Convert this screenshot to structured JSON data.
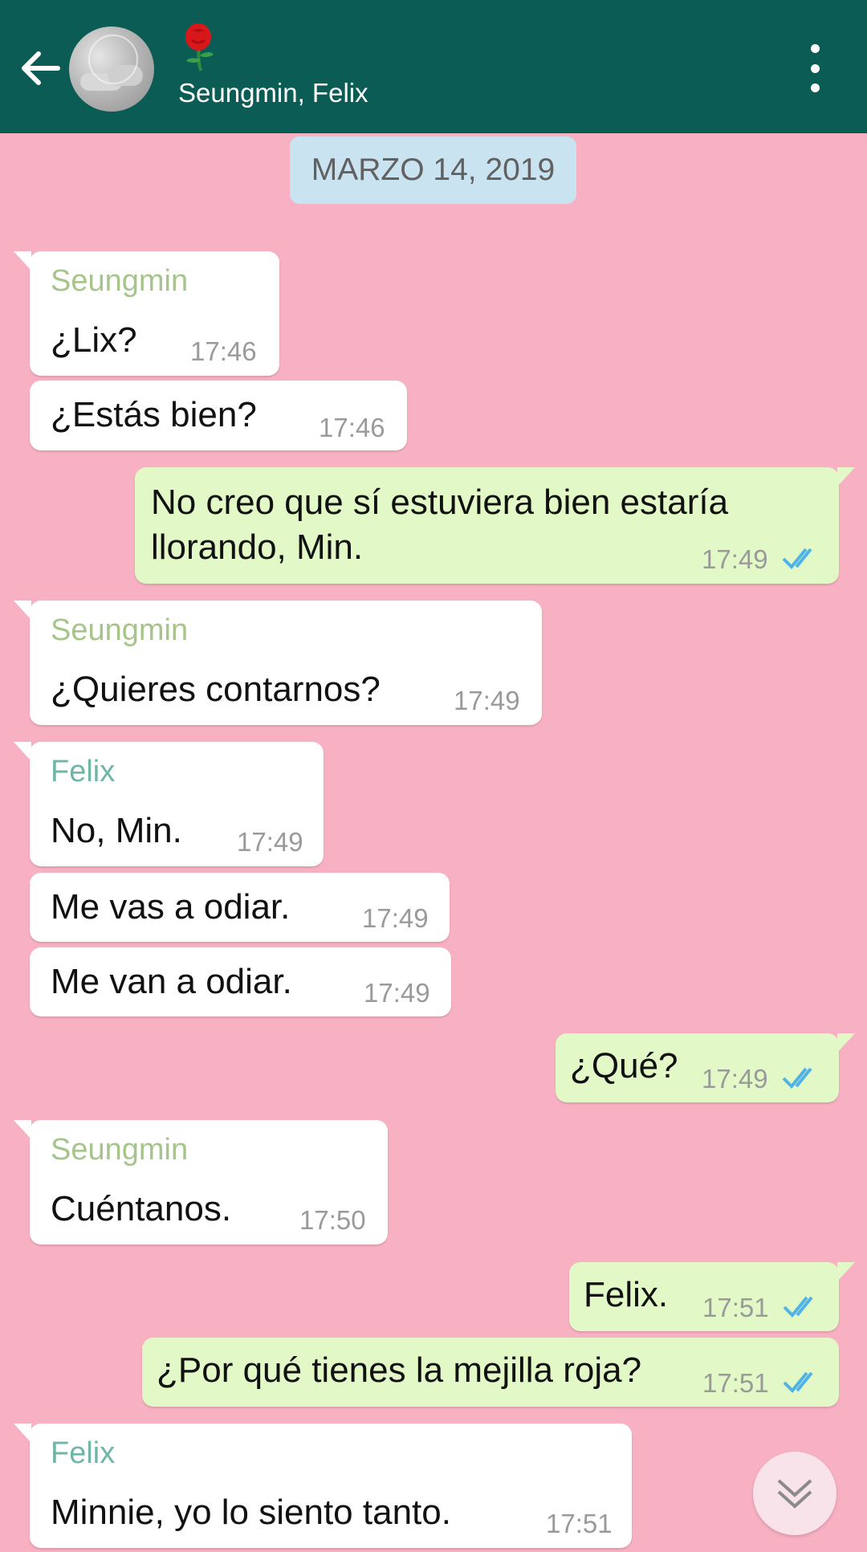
{
  "header": {
    "back_icon": "arrow-left-icon",
    "avatar_icon": "group-avatar",
    "title_emoji": "rose",
    "members": "Seungmin, Felix",
    "menu_icon": "more-vertical-icon"
  },
  "date_separator": "MARZO 14, 2019",
  "messages": [
    {
      "sender": "Seungmin",
      "text": "¿Lix?",
      "time": "17:46"
    },
    {
      "text": "¿Estás bien?",
      "time": "17:46"
    },
    {
      "text": "No creo que sí estuviera bien estaría llorando, Min.",
      "time": "17:49",
      "read": true
    },
    {
      "sender": "Seungmin",
      "text": "¿Quieres contarnos?",
      "time": "17:49"
    },
    {
      "sender": "Felix",
      "text": "No, Min.",
      "time": "17:49"
    },
    {
      "text": "Me vas a odiar.",
      "time": "17:49"
    },
    {
      "text": "Me van a odiar.",
      "time": "17:49"
    },
    {
      "text": "¿Qué?",
      "time": "17:49",
      "read": true
    },
    {
      "sender": "Seungmin",
      "text": "Cuéntanos.",
      "time": "17:50"
    },
    {
      "text": "Felix.",
      "time": "17:51",
      "read": true
    },
    {
      "text": "¿Por qué tienes la mejilla roja?",
      "time": "17:51",
      "read": true
    },
    {
      "sender": "Felix",
      "text": "Minnie, yo lo siento tanto.",
      "time": "17:51"
    }
  ],
  "colors": {
    "header_bg": "#0b5c55",
    "chat_bg": "#f8b1c3",
    "incoming_bubble": "#ffffff",
    "outgoing_bubble": "#e2f8c6",
    "seungmin_name": "#a6c48b",
    "felix_name": "#6fb5a8",
    "read_ticks": "#4fb3e8"
  },
  "scroll_icon": "chevron-double-down-icon"
}
